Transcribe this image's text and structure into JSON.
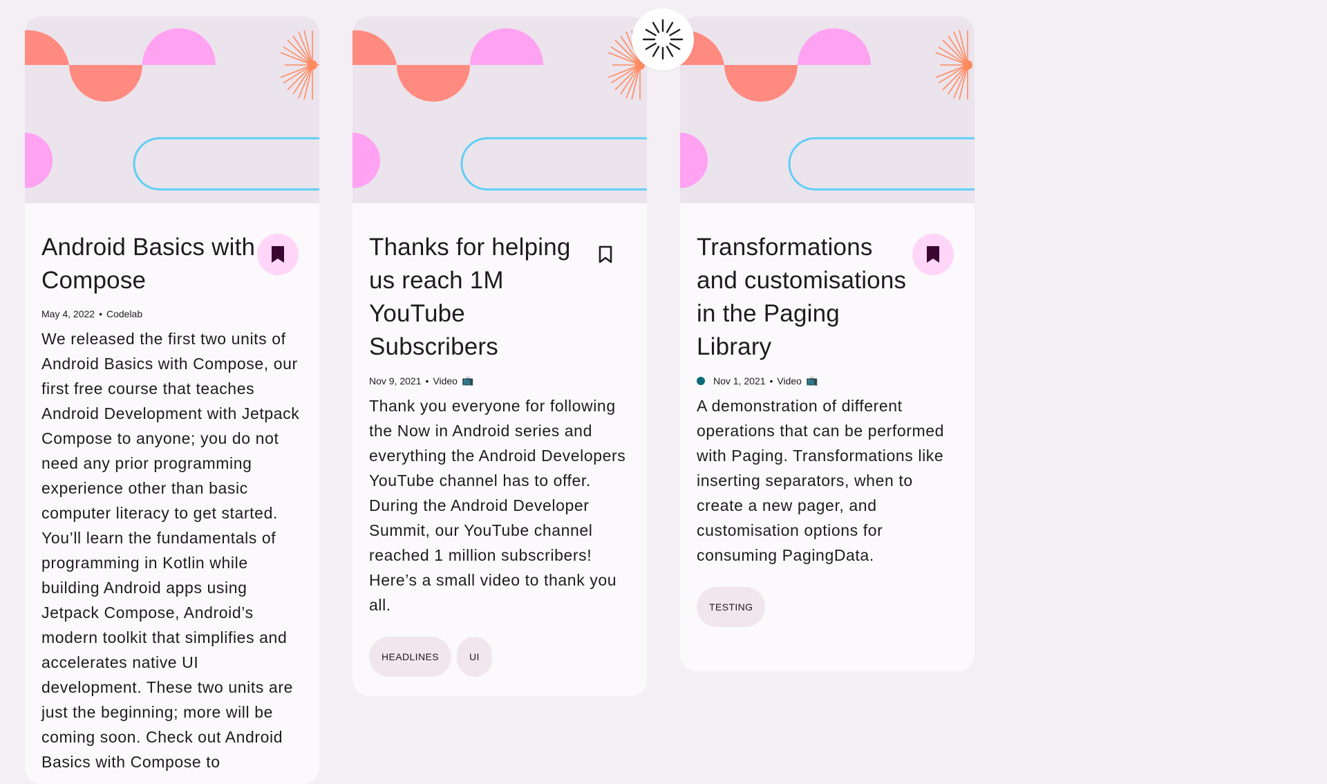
{
  "colors": {
    "background": "#f4eff4",
    "card": "#fbf9fb",
    "accent_pink": "#ffd6f8",
    "bookmark_fill": "#3a0632",
    "chip": "#f1e6ee",
    "unread_dot": "#0b6a7a"
  },
  "cards": [
    {
      "title": "Android Basics with Compose",
      "bookmarked": true,
      "date": "May 4, 2022",
      "separator": "•",
      "type": "Codelab",
      "type_icon": "",
      "unread": false,
      "description": "We released the first two units of Android Basics with Compose, our first free course that teaches Android Development with Jetpack Compose to anyone; you do not need any prior programming experience other than basic computer literacy to get started. You’ll learn the fundamentals of programming in Kotlin while building Android apps using Jetpack Compose, Android’s modern toolkit that simplifies and accelerates native UI development. These two units are just the beginning; more will be coming soon. Check out Android Basics with Compose to",
      "topics": []
    },
    {
      "title": "Thanks for helping us reach 1M YouTube Subscribers",
      "bookmarked": false,
      "date": "Nov 9, 2021",
      "separator": "•",
      "type": "Video",
      "type_icon": "📺",
      "unread": false,
      "description": "Thank you everyone for following the Now in Android series and everything the Android Developers YouTube channel has to offer. During the Android Developer Summit, our YouTube channel reached 1 million subscribers! Here’s a small video to thank you all.",
      "topics": [
        "HEADLINES",
        "UI"
      ]
    },
    {
      "title": "Transformations and customisations in the Paging Library",
      "bookmarked": true,
      "date": "Nov 1, 2021",
      "separator": "•",
      "type": "Video",
      "type_icon": "📺",
      "unread": true,
      "description": "A demonstration of different operations that can be performed with Paging. Transformations like inserting separators, when to create a new pager, and customisation options for consuming PagingData.",
      "topics": [
        "TESTING"
      ]
    }
  ],
  "icons": {
    "bookmark": "bookmark-icon",
    "loading": "loading-spinner-icon"
  }
}
